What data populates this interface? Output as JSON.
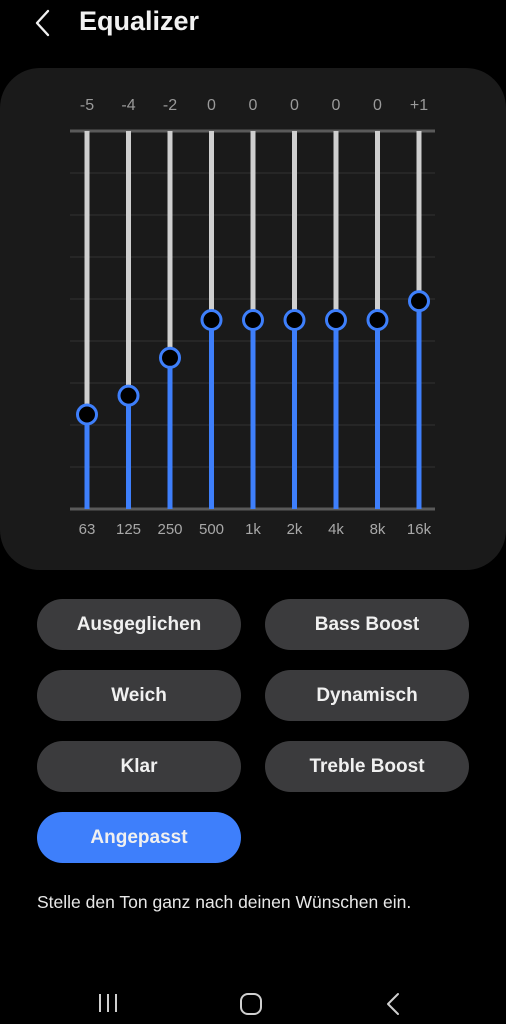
{
  "header": {
    "title": "Equalizer",
    "back_icon": "chevron-left-icon"
  },
  "chart_data": {
    "type": "bar",
    "title": "Equalizer",
    "categories": [
      "63",
      "125",
      "250",
      "500",
      "1k",
      "2k",
      "4k",
      "8k",
      "16k"
    ],
    "values": [
      -5,
      -4,
      -2,
      0,
      0,
      0,
      0,
      0,
      1
    ],
    "value_labels": [
      "-5",
      "-4",
      "-2",
      "0",
      "0",
      "0",
      "0",
      "0",
      "+1"
    ],
    "ylim": [
      -10,
      10
    ],
    "grid": true,
    "colors": {
      "active": "#3e7ffb",
      "track": "#cfcfcf",
      "grid": "#333333",
      "axis": "#5a5a5a"
    }
  },
  "presets": [
    {
      "label": "Ausgeglichen",
      "active": false
    },
    {
      "label": "Bass Boost",
      "active": false
    },
    {
      "label": "Weich",
      "active": false
    },
    {
      "label": "Dynamisch",
      "active": false
    },
    {
      "label": "Klar",
      "active": false
    },
    {
      "label": "Treble Boost",
      "active": false
    },
    {
      "label": "Angepasst",
      "active": true
    }
  ],
  "description": "Stelle den Ton ganz nach deinen Wünschen ein.",
  "navbar": {
    "recents_icon": "recents-icon",
    "home_icon": "home-icon",
    "back_icon": "back-icon"
  }
}
